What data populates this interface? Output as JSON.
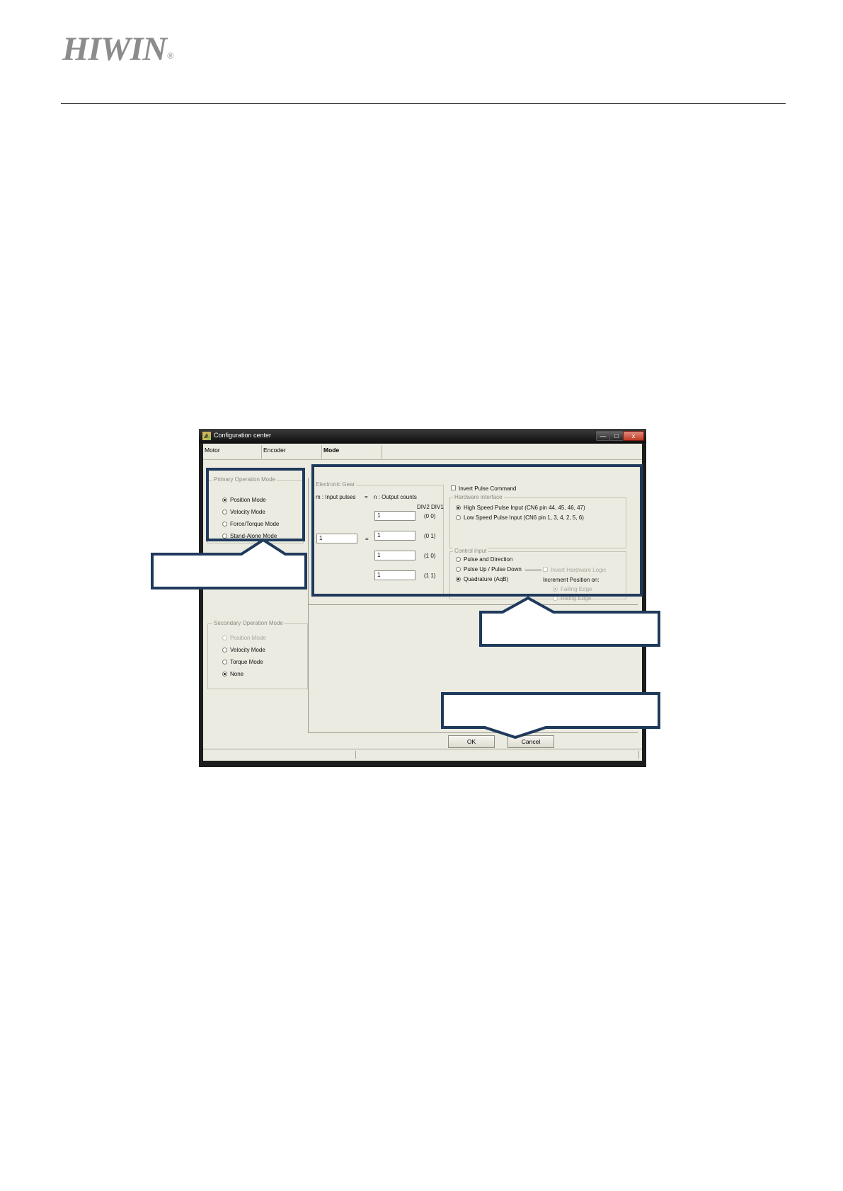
{
  "header": {
    "logo_text": "HIWIN",
    "logo_mark": "®"
  },
  "window": {
    "title": "Configuration center",
    "controls": {
      "minimize": "—",
      "maximize": "□",
      "close": "x"
    }
  },
  "tabs": [
    {
      "label": "Motor"
    },
    {
      "label": "Encoder"
    },
    {
      "label": "Mode"
    }
  ],
  "primary_mode": {
    "title": "Primary Operation Mode",
    "options": [
      {
        "label": "Position Mode",
        "selected": true
      },
      {
        "label": "Velocity Mode",
        "selected": false
      },
      {
        "label": "Force/Torque Mode",
        "selected": false
      },
      {
        "label": "Stand-Alone Mode",
        "selected": false
      }
    ]
  },
  "secondary_mode": {
    "title": "Secondary Operation Mode",
    "options": [
      {
        "label": "Position Mode",
        "selected": false,
        "disabled": true
      },
      {
        "label": "Velocity Mode",
        "selected": false
      },
      {
        "label": "Torque Mode",
        "selected": false
      },
      {
        "label": "None",
        "selected": true
      }
    ]
  },
  "electronic_gear": {
    "title": "Electronic Gear",
    "m_label": "m : Input pulses",
    "equals_top": "=",
    "n_label": "n : Output counts",
    "div_header": "DIV2 DIV1",
    "equals_mid": "=",
    "m_value": "1",
    "rows": [
      {
        "value": "1",
        "code": "(0 0)"
      },
      {
        "value": "1",
        "code": "(0 1)"
      },
      {
        "value": "1",
        "code": "(1 0)"
      },
      {
        "value": "1",
        "code": "(1 1)"
      }
    ]
  },
  "invert_pulse": {
    "label": "Invert Pulse Command",
    "checked": false
  },
  "hardware_interface": {
    "title": "Hardware interface",
    "options": [
      {
        "label": "High Speed Pulse Input (CN6 pin 44, 45, 46, 47)",
        "selected": true
      },
      {
        "label": "Low Speed Pulse Input (CN6 pin 1, 3, 4, 2, 5, 6)",
        "selected": false
      }
    ]
  },
  "control_input": {
    "title": "Control input",
    "options": [
      {
        "label": "Pulse and Direction",
        "selected": false
      },
      {
        "label": "Pulse Up / Pulse Down",
        "selected": false
      },
      {
        "label": "Quadrature (AqB)",
        "selected": true
      }
    ],
    "invert_hw_logic": "Invert Hardware Logic",
    "increment_label": "Increment Position on:",
    "edge_options": [
      {
        "label": "Falling Edge",
        "selected": true
      },
      {
        "label": "Rising Edge",
        "selected": false
      }
    ]
  },
  "buttons": {
    "ok": "OK",
    "cancel": "Cancel"
  },
  "colors": {
    "callout": "#1f3a5c",
    "client_bg": "#ecebe1",
    "titlebar": "#1a1a1a"
  }
}
